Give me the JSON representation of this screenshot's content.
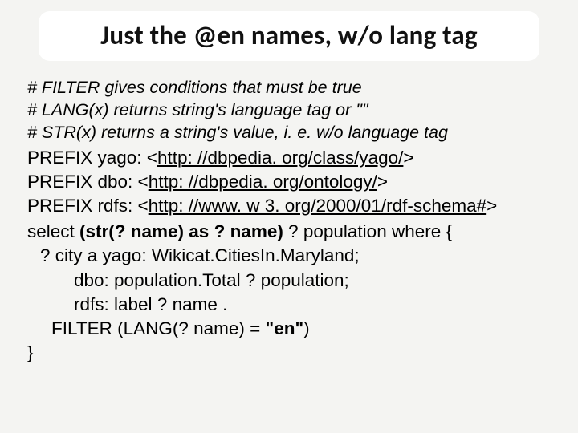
{
  "title": "Just the @en names, w/o lang tag",
  "comments": {
    "c1": "# FILTER gives conditions that must be true",
    "c2": "# LANG(x) returns string's language tag or \"\"",
    "c3": "# STR(x) returns a string's value, i. e. w/o language tag"
  },
  "prefixes": {
    "p1_pre": "PREFIX yago:  <",
    "p1_url": "http: //dbpedia. org/class/yago/",
    "p1_post": ">",
    "p2_pre": "PREFIX dbo: <",
    "p2_url": "http: //dbpedia. org/ontology/",
    "p2_post": ">",
    "p3_pre": "PREFIX rdfs: <",
    "p3_url": "http: //www. w 3. org/2000/01/rdf-schema#",
    "p3_post": ">"
  },
  "query": {
    "select_pre": "select ",
    "select_bold": "(str(? name) as ? name)",
    "select_post": " ? population where {",
    "l2": "? city a yago: Wikicat.CitiesIn.Maryland;",
    "l3": "dbo: population.Total ? population;",
    "l4": "rdfs: label ? name .",
    "filter_pre": "FILTER (LANG(? name) = ",
    "filter_bold": "\"en\"",
    "filter_post": ")",
    "l6": "}"
  }
}
